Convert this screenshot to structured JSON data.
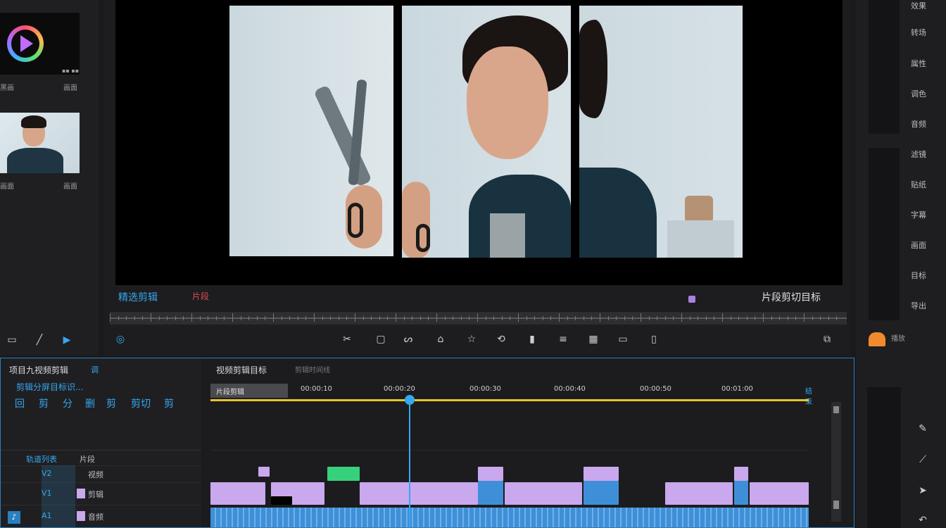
{
  "media_panel": {
    "item1_label": "黑画",
    "item1_duration": "画面",
    "item2_label": "画面",
    "item2_duration": "画面"
  },
  "preview": {
    "left_label": "精选剪辑",
    "left_badge": "片段",
    "right_label": "片段剪切目标",
    "timecodes": [
      "II",
      "II",
      "II",
      "II",
      "II"
    ]
  },
  "toolbar": {
    "icons": [
      "cut-icon",
      "crop-icon",
      "pen-icon",
      "tag-icon",
      "star-icon",
      "split-icon",
      "bars-icon",
      "list-icon",
      "grid-icon",
      "monitor-icon",
      "file-icon"
    ],
    "export_label": "导出"
  },
  "left_tools": {
    "title": "项目九视频剪辑",
    "badge": "调",
    "subtitle": "剪辑分屏目标识...",
    "buttons": [
      "回",
      "剪",
      "分",
      "删",
      "剪",
      "剪切",
      "剪"
    ]
  },
  "track_headers": {
    "header_label": "轨道列表",
    "header_value": "片段",
    "rows": [
      {
        "name": "V2",
        "label": "视频"
      },
      {
        "name": "V1",
        "label": "剪辑"
      },
      {
        "name": "A1",
        "label": "音频"
      }
    ]
  },
  "timeline": {
    "title": "视频剪辑目标",
    "subtitle": "剪辑时间线",
    "clip_label": "片段剪辑",
    "ruler_labels": [
      "00:00:10",
      "00:00:20",
      "00:00:30",
      "00:00:40",
      "00:00:50",
      "00:01:00"
    ],
    "end_label": "结束"
  },
  "right_panel": {
    "items": [
      "效果",
      "转场",
      "属性",
      "调色",
      "音频",
      "滤镜",
      "贴纸",
      "字幕",
      "画面",
      "目标",
      "导出"
    ],
    "bottom_label": "播放"
  },
  "colors": {
    "accent": "#35a8f0",
    "clip_purple": "#c9a8ee",
    "clip_blue": "#3f8fd8",
    "clip_green": "#35d17c",
    "playhead": "#35a8f0",
    "timeline_yellow": "#e8c22a"
  }
}
